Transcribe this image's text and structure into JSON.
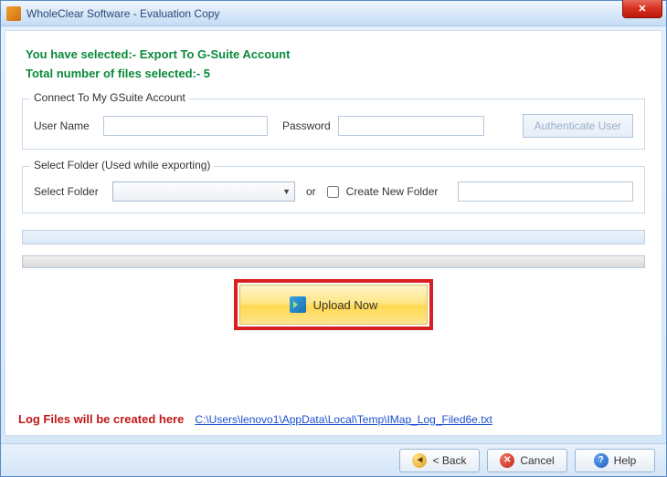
{
  "titlebar": {
    "title": "WholeClear Software - Evaluation Copy"
  },
  "summary": {
    "selected_line": "You have selected:- Export To G-Suite Account",
    "total_line": "Total number of files selected:- 5"
  },
  "connect": {
    "legend": "Connect To My GSuite Account",
    "username_label": "User Name",
    "username_value": "",
    "password_label": "Password",
    "password_value": "",
    "auth_button": "Authenticate User"
  },
  "folder": {
    "legend": "Select Folder (Used while exporting)",
    "select_label": "Select Folder",
    "select_value": "",
    "or_text": "or",
    "create_label": "Create New Folder",
    "create_value": ""
  },
  "upload": {
    "button_label": "Upload Now"
  },
  "log": {
    "label": "Log Files will be created here",
    "path": "C:\\Users\\lenovo1\\AppData\\Local\\Temp\\IMap_Log_Filed6e.txt"
  },
  "footer": {
    "back": "< Back",
    "cancel": "Cancel",
    "help": "Help"
  }
}
